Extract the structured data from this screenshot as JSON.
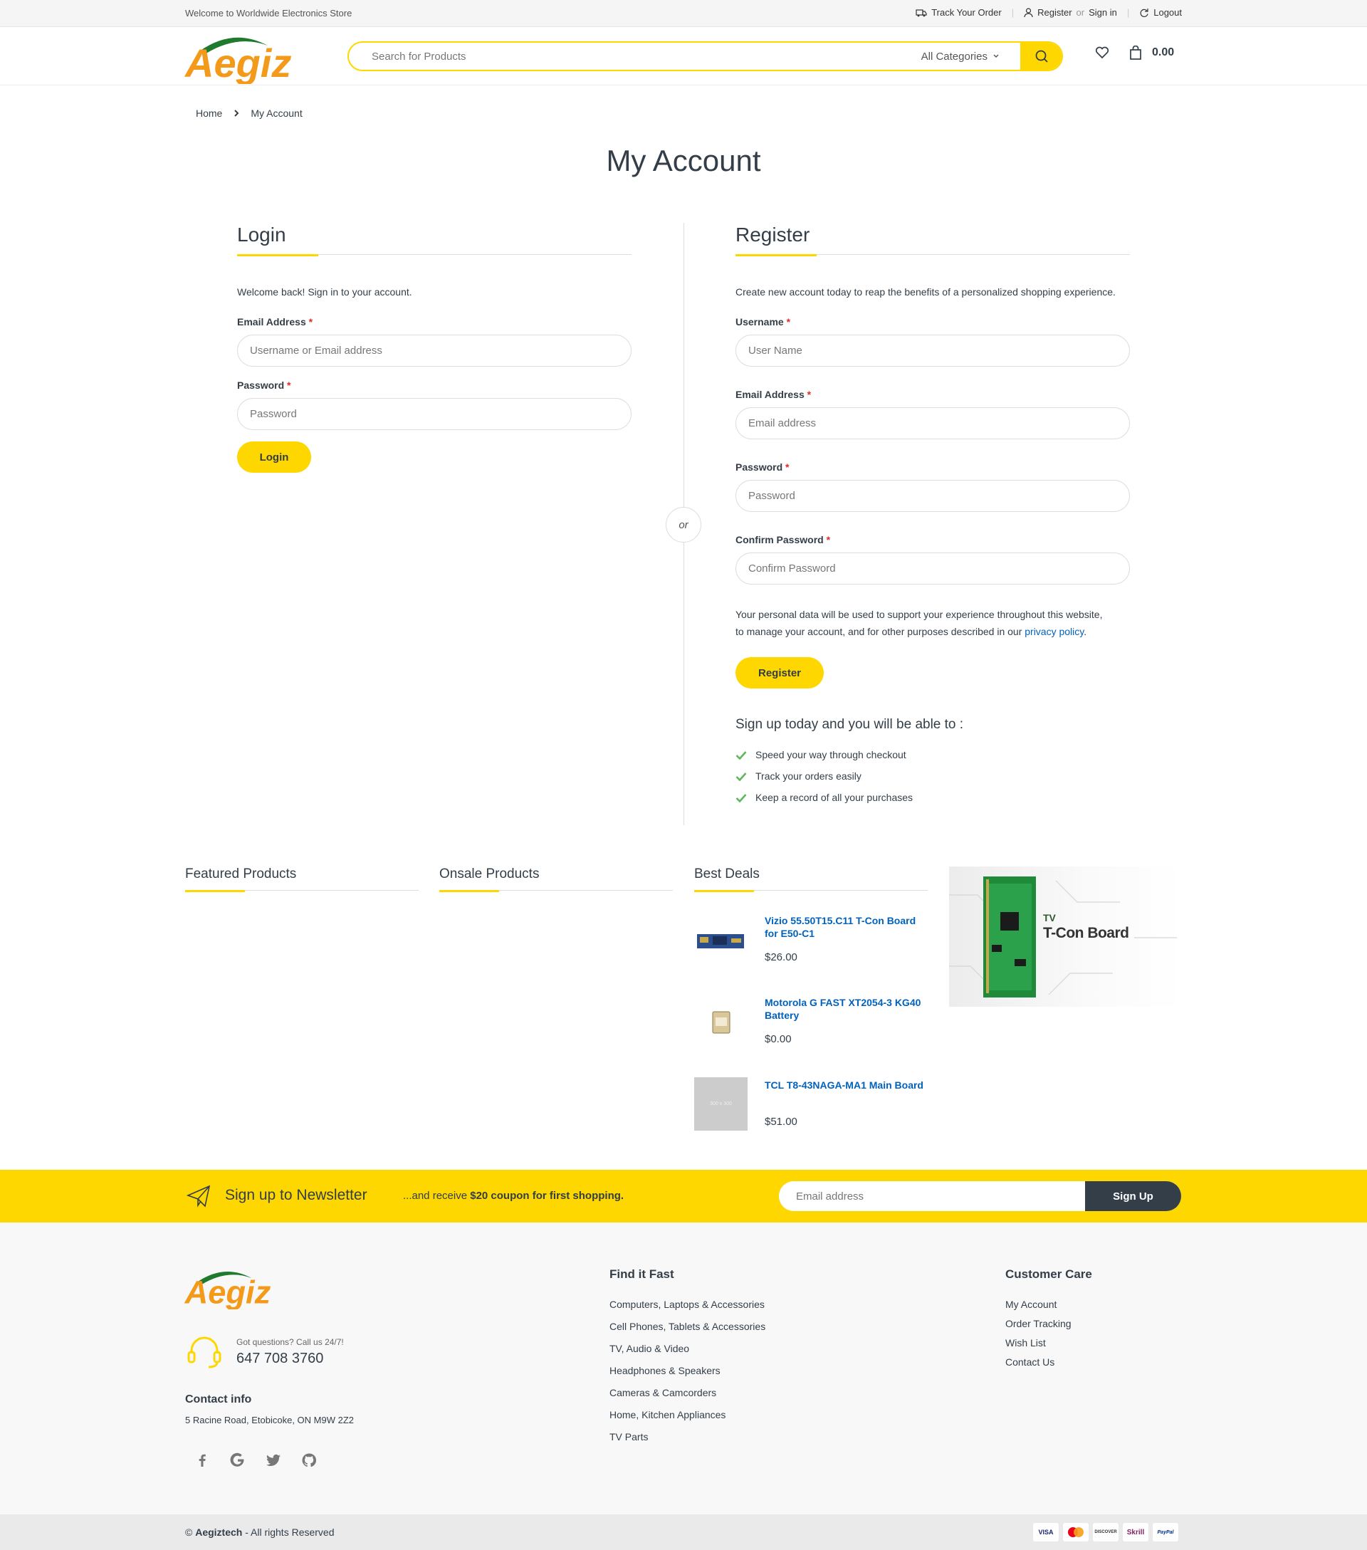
{
  "topbar": {
    "welcome": "Welcome to Worldwide Electronics Store",
    "track_order": "Track Your Order",
    "register": "Register",
    "or": "or",
    "sign_in": "Sign in",
    "logout": "Logout"
  },
  "header": {
    "logo_text": "Aegiz",
    "search_placeholder": "Search for Products",
    "category": "All Categories",
    "cart_total": "0.00"
  },
  "breadcrumb": {
    "home": "Home",
    "current": "My Account"
  },
  "page_title": "My Account",
  "login": {
    "heading": "Login",
    "intro": "Welcome back! Sign in to your account.",
    "email_label": "Email Address",
    "email_placeholder": "Username or Email address",
    "password_label": "Password",
    "password_placeholder": "Password",
    "button": "Login"
  },
  "or_badge": "or",
  "register": {
    "heading": "Register",
    "intro": "Create new account today to reap the benefits of a personalized shopping experience.",
    "username_label": "Username",
    "username_placeholder": "User Name",
    "email_label": "Email Address",
    "email_placeholder": "Email address",
    "password_label": "Password",
    "password_placeholder": "Password",
    "confirm_label": "Confirm Password",
    "confirm_placeholder": "Confirm Password",
    "privacy_text_1": "Your personal data will be used to support your experience throughout this website,",
    "privacy_text_2": "to manage your account, and for other purposes described in our",
    "privacy_link": "privacy policy",
    "button": "Register",
    "signup_heading": "Sign up today and you will be able to :",
    "benefits": [
      "Speed your way through checkout",
      "Track your orders easily",
      "Keep a record of all your purchases"
    ]
  },
  "required_mark": "*",
  "products": {
    "featured": "Featured Products",
    "onsale": "Onsale Products",
    "best_deals": "Best Deals",
    "items": [
      {
        "name_1": "Vizio 55.50T15.C11 T-Con Board",
        "name_2": "for E50-C1",
        "price": "$26.00"
      },
      {
        "name_1": "Motorola G FAST XT2054-3 KG40",
        "name_2": "Battery",
        "price": "$0.00"
      },
      {
        "name_1": "TCL T8-43NAGA-MA1 Main Board",
        "name_2": "",
        "price": "$51.00"
      }
    ],
    "banner_small": "TV",
    "banner_big": "T-Con Board",
    "placeholder_text": "300 x 300"
  },
  "newsletter": {
    "title": "Sign up to Newsletter",
    "sub_prefix": "...and receive",
    "sub_bold": "$20 coupon for first shopping.",
    "placeholder": "Email address",
    "button": "Sign Up"
  },
  "footer": {
    "logo_text": "Aegiz",
    "questions": "Got questions? Call us 24/7!",
    "phone": "647 708 3760",
    "contact_heading": "Contact info",
    "address": "5 Racine Road, Etobicoke, ON M9W 2Z2",
    "find_heading": "Find it Fast",
    "find_links": [
      "Computers, Laptops & Accessories",
      "Cell Phones, Tablets & Accessories",
      "TV, Audio & Video",
      "Headphones & Speakers",
      "Cameras & Camcorders",
      "Home, Kitchen Appliances",
      "TV Parts"
    ],
    "care_heading": "Customer Care",
    "care_links": [
      "My Account",
      "Order Tracking",
      "Wish List",
      "Contact Us"
    ],
    "copyright_prefix": "©",
    "copyright_brand": "Aegiztech",
    "copyright_suffix": "- All rights Reserved",
    "payments": [
      "VISA",
      "MC",
      "DISCOVER",
      "Skrill",
      "PayPal"
    ]
  },
  "colors": {
    "accent": "#fed700",
    "text": "#333e48",
    "link": "#0062bd",
    "dark": "#333e48",
    "check": "#5cb85c"
  }
}
